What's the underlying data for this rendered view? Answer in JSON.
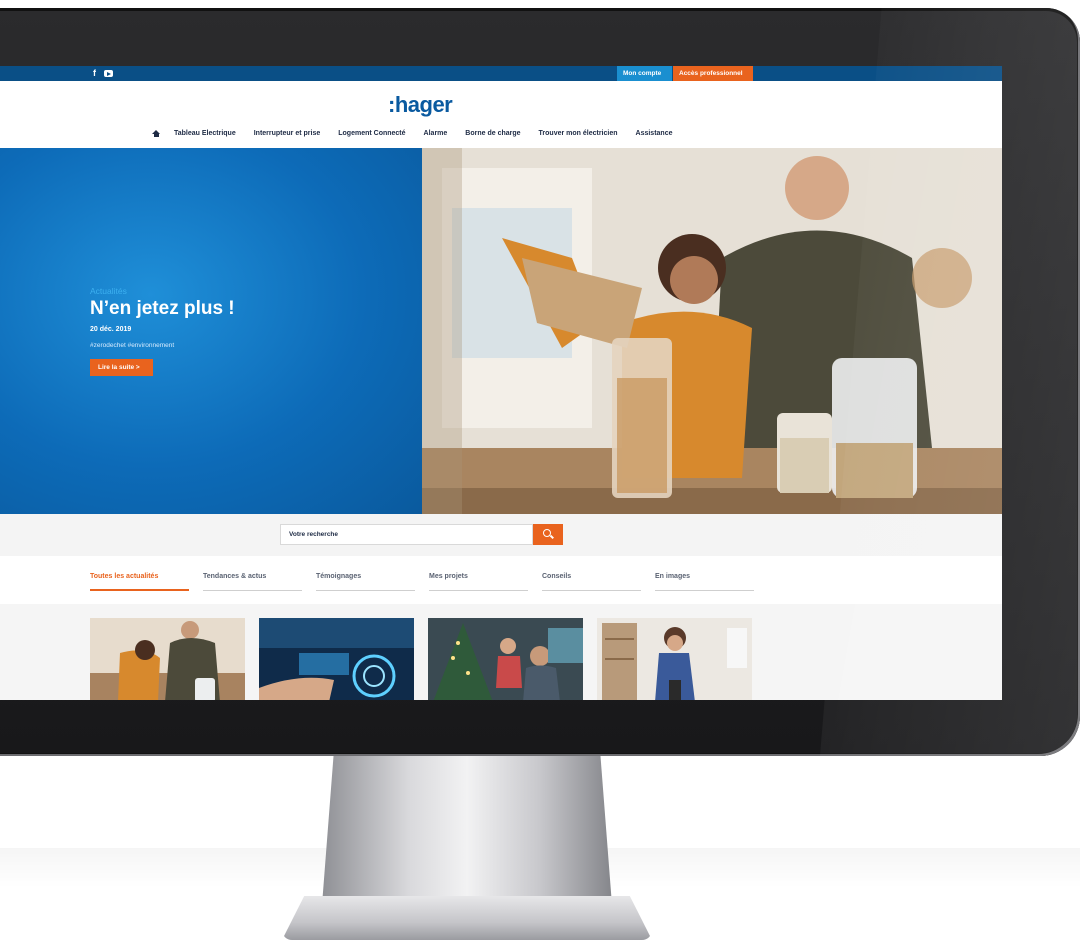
{
  "topbar": {
    "social": [
      "f"
    ],
    "account_button": "Mon compte  >",
    "pro_button": "Accès professionnel  >"
  },
  "header": {
    "logo": ":hager",
    "nav": [
      "Tableau Electrique",
      "Interrupteur et prise",
      "Logement Connecté",
      "Alarme",
      "Borne de charge",
      "Trouver mon électricien",
      "Assistance"
    ]
  },
  "hero": {
    "category": "Actualités",
    "title": "N’en jetez plus !",
    "date": "20 déc. 2019",
    "tags": "#zerodechet #environnement",
    "cta": "Lire la suite  >"
  },
  "search": {
    "placeholder": "Votre recherche"
  },
  "tabs": [
    "Toutes les actualités",
    "Tendances & actus",
    "Témoignages",
    "Mes projets",
    "Conseils",
    "En images"
  ],
  "colors": {
    "brand_blue": "#0a4f86",
    "accent_orange": "#e9631e",
    "hero_blue": "#0d6bb8"
  },
  "icons": [
    "facebook-icon",
    "youtube-icon",
    "home-icon",
    "search-icon",
    "chevron-right-icon"
  ]
}
